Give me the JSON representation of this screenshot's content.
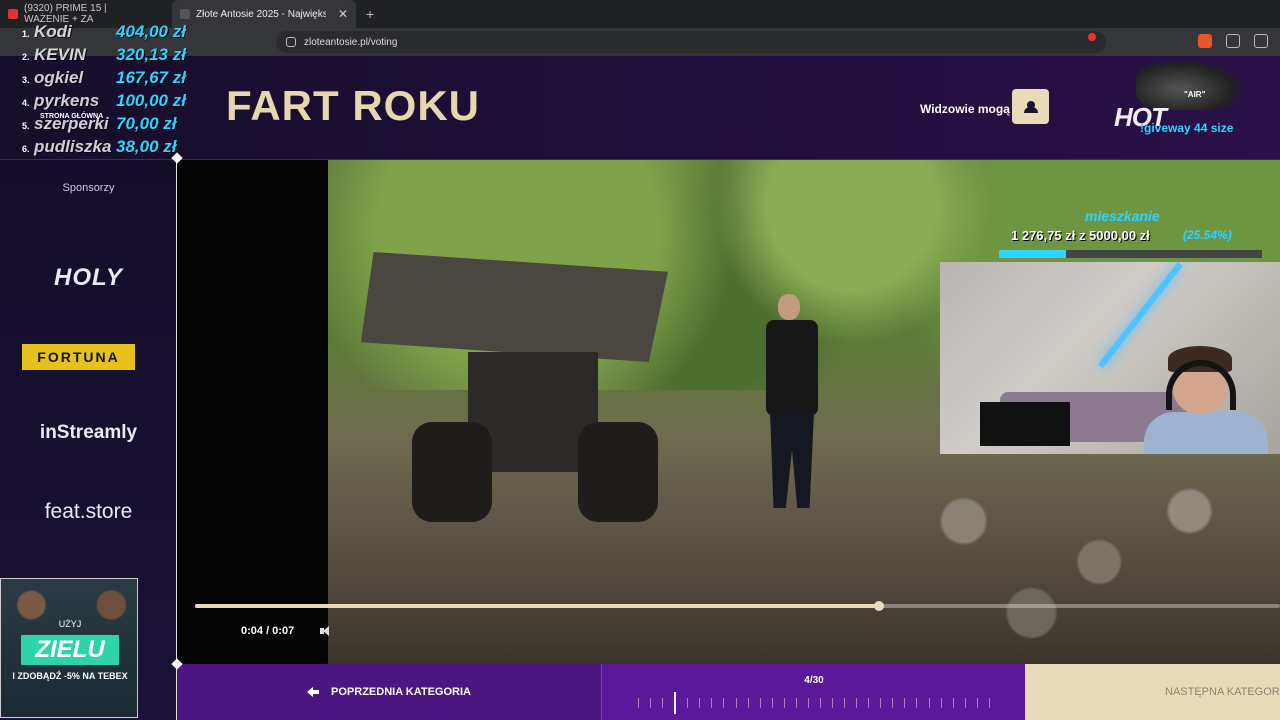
{
  "browser": {
    "tabs": [
      {
        "label": "(9320) PRIME 15 | WAŻENIE + ZA",
        "active": false
      },
      {
        "label": "Złote Antosie 2025 - Największ",
        "active": true
      }
    ],
    "url": "zloteantosie.pl/voting"
  },
  "header": {
    "category_title": "FART ROKU",
    "viewers_label": "Widzowie mogą"
  },
  "sidebar": {
    "sponsors_label": "Sponsorzy",
    "sponsors": [
      "HOLY",
      "FORTUNA",
      "inStreamly",
      "feat.store"
    ]
  },
  "leaderboard": [
    {
      "rank": "1.",
      "name": "Kodi",
      "amount": "404,00 zł"
    },
    {
      "rank": "2.",
      "name": "KEVIN",
      "amount": "320,13 zł"
    },
    {
      "rank": "3.",
      "name": "ogkiel",
      "amount": "167,67 zł"
    },
    {
      "rank": "4.",
      "name": "pyrkens",
      "amount": "100,00 zł"
    },
    {
      "rank": "5.",
      "name": "szerperki",
      "amount": "70,00 zł"
    },
    {
      "rank": "6.",
      "name": "pudliszka",
      "amount": "38,00 zł"
    }
  ],
  "home_label": "STRONA GŁÓWNA",
  "giveaway": {
    "shoe_text": "\"AIR\"",
    "brand_text": "HOT",
    "text": "!giveway 44 size"
  },
  "goal": {
    "title": "mieszkanie",
    "amount": "1 276,75 zł z 5000,00 zł",
    "percent": "(25.54%)",
    "fraction": 0.2554
  },
  "video": {
    "time": "0:04 / 0:07",
    "progress": 0.63
  },
  "bottom_nav": {
    "prev_label": "POPRZEDNIA KATEGORIA",
    "counter": "4/30",
    "current_index": 4,
    "total": 30,
    "next_label": "NASTĘPNA KATEGORIA"
  },
  "promo": {
    "use_label": "UŻYJ",
    "code": "ZIELU",
    "sub_label": "I ZDOBĄDŹ -5% NA TEBEX"
  },
  "colors": {
    "accent_gold": "#e8dcb8",
    "accent_purple": "#5a189a",
    "overlay_cyan": "#2fd3ff"
  }
}
